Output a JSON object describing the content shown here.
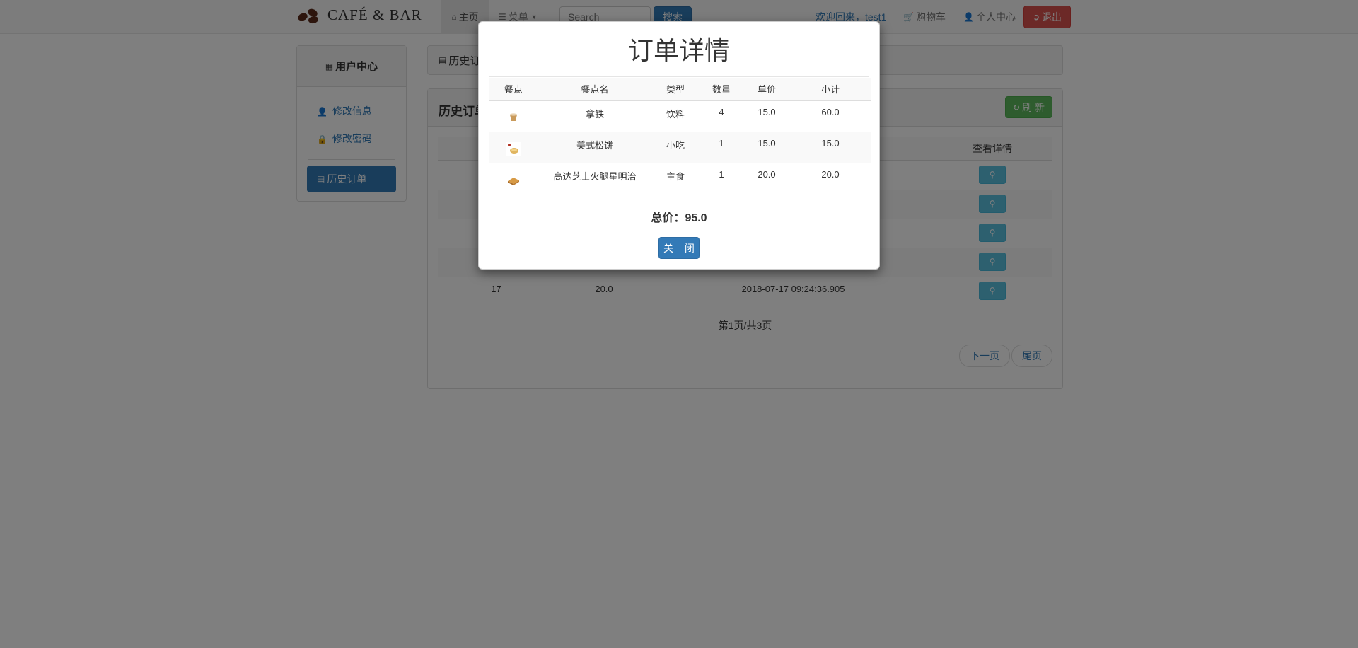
{
  "navbar": {
    "brand": "CAFÉ & BAR",
    "home": "主页",
    "menu": "菜单",
    "search_placeholder": "Search",
    "search_button": "搜索",
    "welcome": "欢迎回来，test1",
    "cart": "购物车",
    "user_center": "个人中心",
    "logout": "退出"
  },
  "sidebar": {
    "title": "用户中心",
    "items": [
      {
        "label": "修改信息",
        "icon": "user-icon"
      },
      {
        "label": "修改密码",
        "icon": "lock-icon"
      },
      {
        "label": "历史订单",
        "icon": "list-icon",
        "active": true
      }
    ]
  },
  "main": {
    "breadcrumb": "历史订单",
    "panel_title": "历史订单",
    "refresh_button": "刷 新",
    "columns": [
      "",
      "",
      "",
      "查看详情"
    ],
    "visible_row": {
      "id": "17",
      "total": "20.0",
      "time": "2018-07-17 09:24:36.905"
    },
    "page_info": "第1页/共3页",
    "next_page": "下一页",
    "last_page": "尾页"
  },
  "modal": {
    "title": "订单详情",
    "columns": [
      "餐点",
      "餐点名",
      "类型",
      "数量",
      "单价",
      "小计"
    ],
    "items": [
      {
        "thumb": "latte-cup-icon",
        "name": "拿铁",
        "type": "饮料",
        "qty": "4",
        "price": "15.0",
        "subtotal": "60.0"
      },
      {
        "thumb": "muffin-icon",
        "name": "美式松饼",
        "type": "小吃",
        "qty": "1",
        "price": "15.0",
        "subtotal": "15.0"
      },
      {
        "thumb": "sandwich-icon",
        "name": "高达芝士火腿星明治",
        "type": "主食",
        "qty": "1",
        "price": "20.0",
        "subtotal": "20.0"
      }
    ],
    "total_label": "总价：",
    "total_value": "95.0",
    "close_button": "关 闭"
  },
  "colors": {
    "primary": "#337ab7",
    "danger": "#d9534f",
    "success": "#5cb85c",
    "info": "#5bc0de",
    "overlay": "rgba(0,0,0,0.5)"
  }
}
